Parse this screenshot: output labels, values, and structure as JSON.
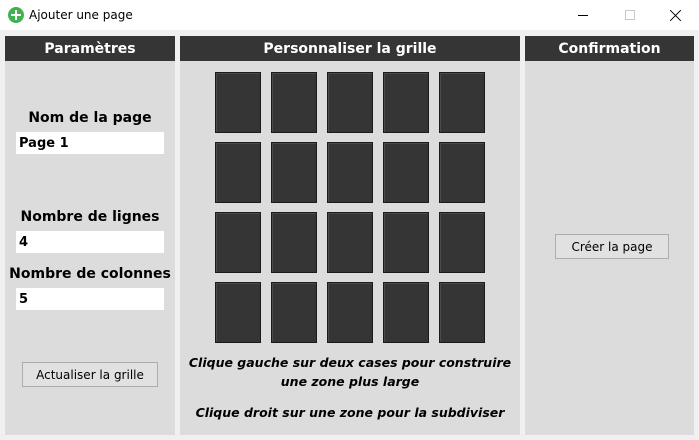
{
  "window": {
    "title": "Ajouter une page",
    "icon": "add-circle-icon",
    "controls": [
      "minimize-icon",
      "maximize-icon",
      "close-icon"
    ]
  },
  "params": {
    "header": "Paramètres",
    "page_name_label": "Nom de la page",
    "page_name_value": "Page 1",
    "rows_label": "Nombre de lignes",
    "rows_value": "4",
    "cols_label": "Nombre de colonnes",
    "cols_value": "5",
    "refresh_button": "Actualiser la grille"
  },
  "grid": {
    "header": "Personnaliser la grille",
    "rows": 4,
    "columns": 5,
    "cell_color": "#353535",
    "hint_merge_line1": "Clique gauche sur deux cases pour construire",
    "hint_merge_line2": "une zone plus large",
    "hint_split": "Clique droit sur une zone pour la subdiviser"
  },
  "confirm": {
    "header": "Confirmation",
    "create_button": "Créer la page"
  },
  "colors": {
    "header_bg": "#353535",
    "panel_bg": "#dcdcdc",
    "accent_green": "#3fb34f"
  }
}
